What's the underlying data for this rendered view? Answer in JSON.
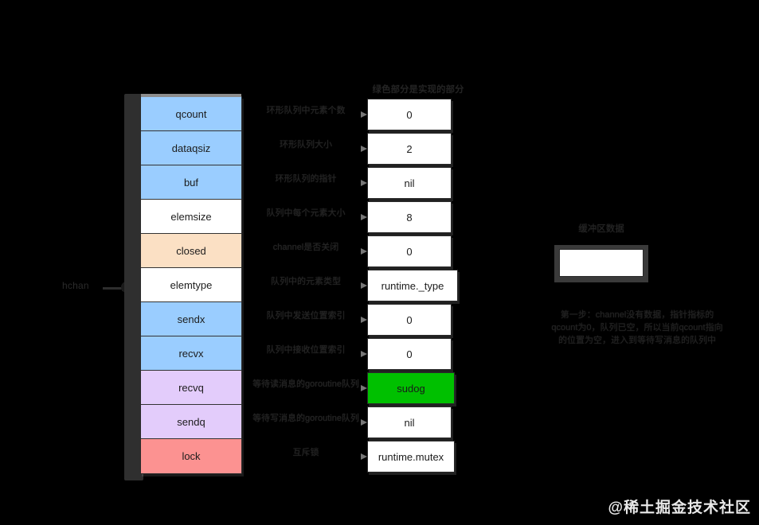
{
  "diagram": {
    "pointer_label": "hchan",
    "value_column_title": "绿色部分是实现的部分",
    "fields": [
      {
        "name": "qcount",
        "desc": "环形队列中元素个数",
        "value": "0",
        "color": "#9acdff"
      },
      {
        "name": "dataqsiz",
        "desc": "环形队列大小",
        "value": "2",
        "color": "#9acdff"
      },
      {
        "name": "buf",
        "desc": "环形队列的指针",
        "value": "nil",
        "color": "#9acdff"
      },
      {
        "name": "elemsize",
        "desc": "队列中每个元素大小",
        "value": "8",
        "color": "#ffffff"
      },
      {
        "name": "closed",
        "desc": "channel是否关闭",
        "value": "0",
        "color": "#fbe0c4"
      },
      {
        "name": "elemtype",
        "desc": "队列中的元素类型",
        "value": "runtime._type",
        "color": "#ffffff"
      },
      {
        "name": "sendx",
        "desc": "队列中发送位置索引",
        "value": "0",
        "color": "#9acdff"
      },
      {
        "name": "recvx",
        "desc": "队列中接收位置索引",
        "value": "0",
        "color": "#9acdff"
      },
      {
        "name": "recvq",
        "desc": "等待读消息的goroutine队列",
        "value": "sudog",
        "color": "#e3ccfb"
      },
      {
        "name": "sendq",
        "desc": "等待写消息的goroutine队列",
        "value": "nil",
        "color": "#e3ccfb"
      },
      {
        "name": "lock",
        "desc": "互斥锁",
        "value": "runtime.mutex",
        "color": "#fc9291"
      }
    ],
    "right_panel": {
      "title": "缓冲区数据",
      "box_value": "",
      "note": "第一步：channel没有数据，指针指标的qcount为0，队列已空，所以当前qcount指向的位置为空，进入到等待写消息的队列中"
    },
    "watermark": "@稀土掘金技术社区",
    "colors": {
      "background": "#000000",
      "blue": "#9acdff",
      "white": "#ffffff",
      "peach": "#fbe0c4",
      "lavender": "#e3ccfb",
      "salmon": "#fc9291",
      "green": "#00c000",
      "bracket": "#2f2f2f"
    }
  }
}
